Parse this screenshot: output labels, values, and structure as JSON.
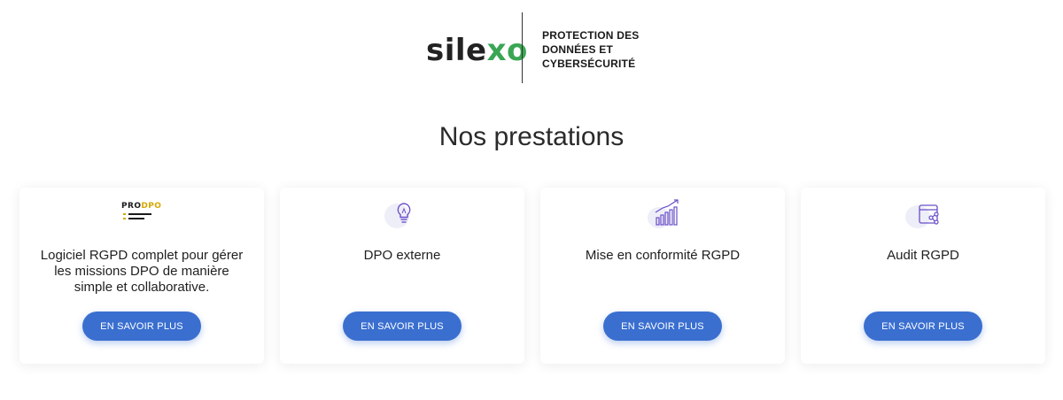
{
  "brand": {
    "logo_prefix": "sile",
    "logo_accent": "x",
    "logo_suffix": "o",
    "tagline": [
      "PROTECTION DES",
      "DONNÉES ET",
      "CYBERSÉCURITÉ"
    ]
  },
  "section_title": "Nos prestations",
  "cards": [
    {
      "icon": "prodpo-logo",
      "logo_text_a": "PRO",
      "logo_text_b": "DPO",
      "text": "Logiciel RGPD complet pour gérer les missions DPO de manière simple et collaborative.",
      "button_label": "EN SAVOIR PLUS"
    },
    {
      "icon": "lightbulb-icon",
      "text": "DPO externe",
      "button_label": "EN SAVOIR PLUS"
    },
    {
      "icon": "bar-chart-growth-icon",
      "text": "Mise en conformité RGPD",
      "button_label": "EN SAVOIR PLUS"
    },
    {
      "icon": "browser-share-icon",
      "text": "Audit RGPD",
      "button_label": "EN SAVOIR PLUS"
    }
  ],
  "colors": {
    "brand_green": "#3aa654",
    "button_blue": "#3a6fd0",
    "icon_purple": "#6a4fc8",
    "icon_bg": "#eeeef8",
    "prodpo_gold": "#d4a700"
  }
}
